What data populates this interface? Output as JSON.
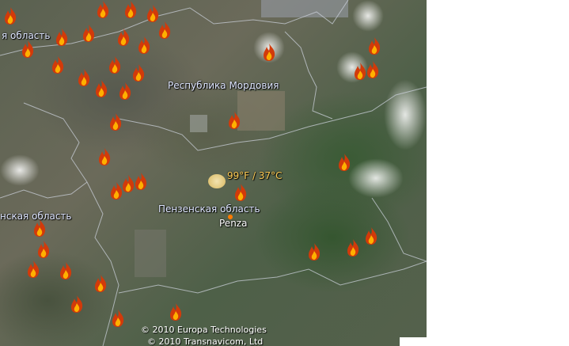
{
  "labels": {
    "mordovia": "Республика Мордовия",
    "penza_oblast": "Пензенская область",
    "penza_city": "Penza",
    "left_oblast_top": "я область",
    "left_oblast_mid": "нская область"
  },
  "weather": {
    "temperature": "99°F / 37°C"
  },
  "attribution": {
    "line1": "© 2010 Europa Technologies",
    "line2": "© 2010 Transnavicom, Ltd"
  },
  "icons": {
    "fire": "fire-icon",
    "weather": "sun-icon"
  },
  "colors": {
    "fire_outer": "#d23a0a",
    "fire_inner": "#ffb000",
    "label": "#dfe6ff",
    "temperature": "#ffcc55"
  }
}
